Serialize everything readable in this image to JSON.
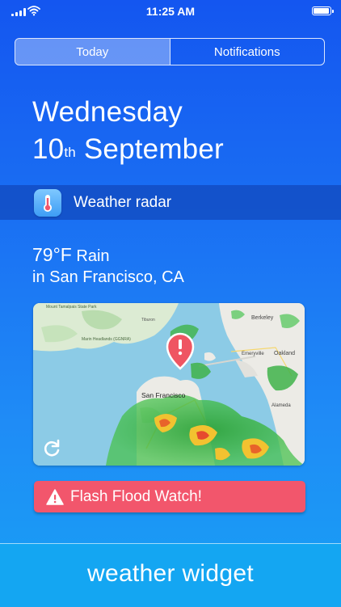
{
  "status_bar": {
    "time": "11:25 AM",
    "battery_level": 0.95
  },
  "tabs": [
    {
      "label": "Today",
      "active": true
    },
    {
      "label": "Notifications",
      "active": false
    }
  ],
  "date": {
    "weekday": "Wednesday",
    "day": "10",
    "suffix": "th",
    "month": "September"
  },
  "widget": {
    "title": "Weather radar",
    "icon": "thermometer-icon",
    "temperature": "79°F",
    "condition": "Rain",
    "location": "in San Francisco, CA"
  },
  "map": {
    "city_label": "San Francisco",
    "labels": [
      "Berkeley",
      "Emeryville",
      "Oakland",
      "Alameda",
      "Marin Headlands (GGNRA)",
      "Mount Tamalpais State Park",
      "Tiburon"
    ],
    "pin_icon": "alert-pin-icon"
  },
  "alert": {
    "text": "Flash Flood Watch!",
    "color": "#f2566c"
  },
  "footer": {
    "text": "weather widget"
  },
  "colors": {
    "accent": "#1a6ff3",
    "header_band": "#0e3caa",
    "alert": "#f2566c"
  }
}
